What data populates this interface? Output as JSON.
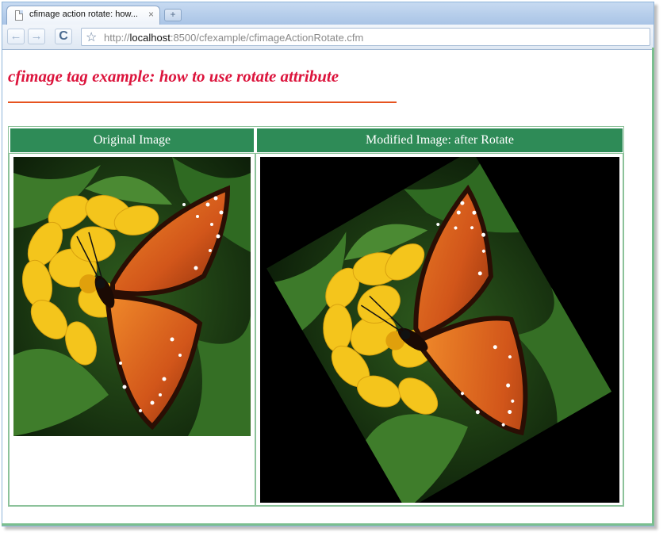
{
  "browser": {
    "tab_title": "cfimage action rotate: how...",
    "tab_close": "×",
    "new_tab": "+",
    "url_scheme": "http://",
    "url_host": "localhost",
    "url_rest": ":8500/cfexample/cfimageActionRotate.cfm",
    "back_icon": "←",
    "forward_icon": "→",
    "reload_icon": "C",
    "star_icon": "☆"
  },
  "page": {
    "title": "cfimage tag example: how to use rotate attribute",
    "title_color": "#dc143c",
    "rule_color": "#e6531f",
    "table": {
      "header_color": "#2e8b57",
      "headers": [
        "Original Image",
        "Modified Image: after Rotate"
      ]
    }
  }
}
